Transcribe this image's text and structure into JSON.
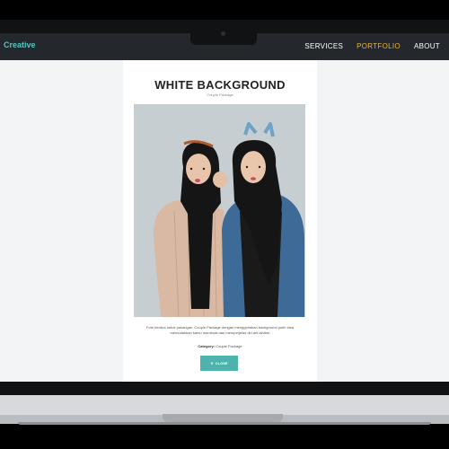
{
  "brand": {
    "name": "Creative"
  },
  "nav": {
    "items": [
      "SERVICES",
      "PORTFOLIO",
      "ABOUT"
    ],
    "active": "PORTFOLIO"
  },
  "portfolio": {
    "title": "WHITE BACKGROUND",
    "subtitle": "Couple Package",
    "description": "Foto berdua untuk pasangan. Couple Package dengan menggunakan background putih bisa memudahkan kamu membuat dan memperjelas diri arti lahiber",
    "category_label": "Category:",
    "category_value": "Couple Package",
    "close_label": "CLOSE",
    "close_icon": "close-x-icon"
  },
  "colors": {
    "accent": "#52c6c0",
    "active_nav": "#e8b23a",
    "navbar_bg": "#24282d",
    "button": "#4fb3ad"
  }
}
